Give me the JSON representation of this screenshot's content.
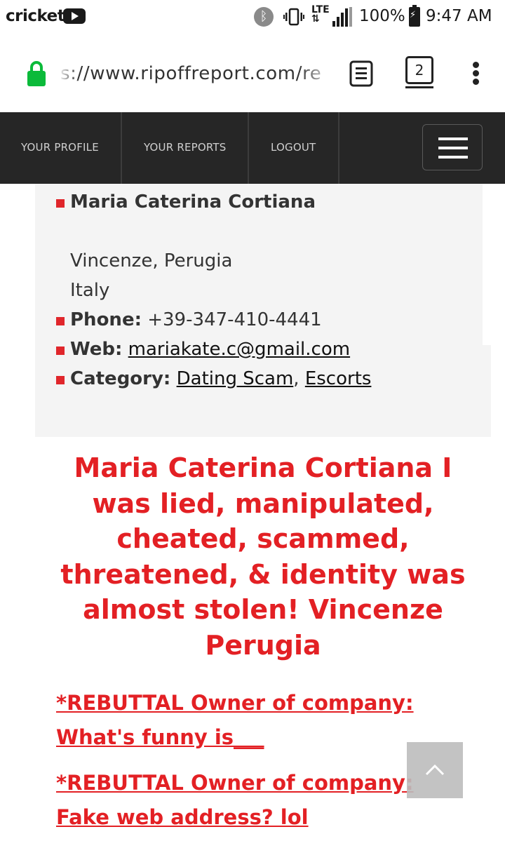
{
  "status_bar": {
    "carrier": "cricket",
    "lte": "LTE",
    "battery": "100%",
    "time": "9:47 AM",
    "icons": [
      "youtube-icon",
      "bluetooth-icon",
      "vibrate-icon",
      "signal-icon",
      "battery-charging-icon"
    ]
  },
  "browser": {
    "url": "s://www.ripoffreport.com/re",
    "tab_count": "2",
    "icons": [
      "lock-icon",
      "reader-mode-icon",
      "tabs-icon",
      "more-menu-icon"
    ]
  },
  "nav": {
    "items": [
      {
        "label": "YOUR PROFILE"
      },
      {
        "label": "YOUR REPORTS"
      },
      {
        "label": "LOGOUT"
      }
    ]
  },
  "report": {
    "name": "Maria Caterina Cortiana",
    "address_line1": "Vincenze, Perugia",
    "address_line2": "Italy",
    "phone_label": "Phone:",
    "phone": "+39-347-410-4441",
    "web_label": "Web:",
    "web": "mariakate.c@gmail.com",
    "category_label": "Category:",
    "category_1": "Dating Scam",
    "category_sep": ",",
    "category_2": "Escorts",
    "title": "Maria Caterina Cortiana I was lied, manipulated, cheated, scammed, threatened, & identity was almost stolen! Vincenze Perugia",
    "rebuttals": [
      "*REBUTTAL Owner of company: What's funny is___",
      "*REBUTTAL Owner of company: Fake web address? lol"
    ]
  },
  "colors": {
    "accent_red": "#e32024",
    "nav_bg": "#262626",
    "info_bg": "#f4f4f4",
    "lock_green": "#0bba3a"
  }
}
